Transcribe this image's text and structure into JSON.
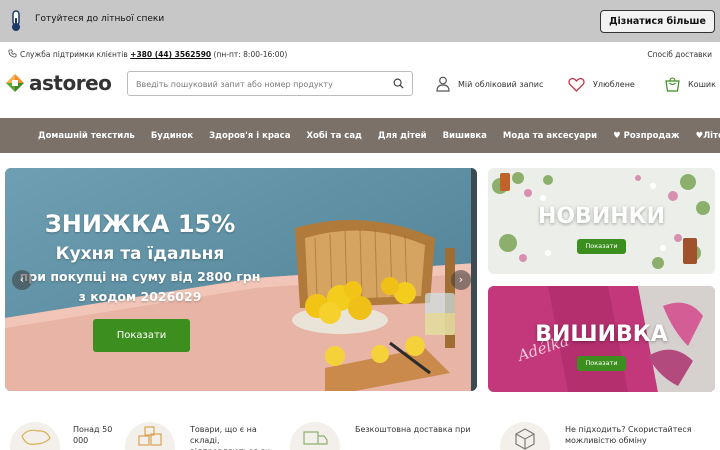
{
  "promo": {
    "text": "Готуйтеся до літньої спеки",
    "button": "Дізнатися більше"
  },
  "support": {
    "label": "Служба підтримки клієнтів",
    "phone": "+380 (44) 3562590",
    "hours": "(пн-пт: 8:00-16:00)",
    "delivery_link": "Спосіб доставки"
  },
  "header": {
    "logo_text": "astoreo",
    "search_placeholder": "Введіть пошуковий запит або номер продукту",
    "account": "Мій обліковий запис",
    "wishlist": "Улюблене",
    "cart": "Кошик"
  },
  "nav": {
    "items": [
      "Домашній текстиль",
      "Будинок",
      "Здоров'я і краса",
      "Хобі та сад",
      "Для дітей",
      "Вишивка",
      "Мода та аксесуари",
      "♥ Розпродаж",
      "♥Літо"
    ]
  },
  "hero": {
    "line1": "ЗНИЖКА 15%",
    "line2": "Кухня та їдальня",
    "line3": "при покупці на суму від 2800 грн",
    "line4": "з кодом 2026029",
    "button": "Показати",
    "prev": "‹",
    "next": "›"
  },
  "side_banners": [
    {
      "title": "НОВИНКИ",
      "button": "Показати"
    },
    {
      "title": "ВИШИВКА",
      "button": "Показати"
    }
  ],
  "features": [
    {
      "text": "Понад 50 000"
    },
    {
      "text": "Товари, що є на складі, відправляються як"
    },
    {
      "text": "Безкоштовна доставка при"
    },
    {
      "text": "Не підходить? Скористайтеся можливістю обміну"
    }
  ],
  "colors": {
    "nav_bg": "#7b7169",
    "promo_bg": "#c7c7c7",
    "accent_green": "#3c8f1e",
    "logo_orange": "#f28c28",
    "logo_green": "#5aa832"
  }
}
